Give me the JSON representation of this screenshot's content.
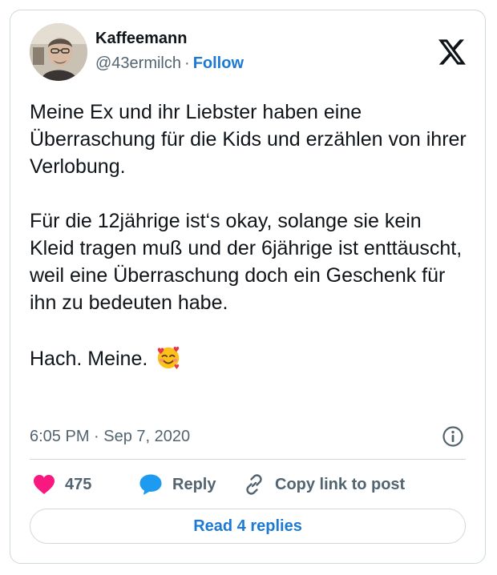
{
  "author": {
    "display_name": "Kaffeemann",
    "handle": "@43ermilch",
    "separator": "·",
    "follow_label": "Follow"
  },
  "tweet": {
    "paragraphs": [
      "Meine Ex und ihr Liebster haben eine Überraschung für die Kids und erzählen von ihrer Verlobung.",
      "Für die 12jährige ist‘s okay, solange sie kein Kleid tragen muß und der 6jährige ist enttäuscht, weil eine Überraschung doch ein Geschenk für ihn zu bedeuten habe.",
      "Hach. Meine."
    ],
    "emoji": "smiling-face-with-hearts-icon",
    "timestamp": "6:05 PM · Sep 7, 2020"
  },
  "actions": {
    "like_count": "475",
    "reply_label": "Reply",
    "copy_link_label": "Copy link to post",
    "read_replies_label": "Read 4 replies"
  },
  "colors": {
    "accent": "#1d7ad4",
    "like": "#f91880",
    "reply_icon": "#1d9bf0",
    "text": "#0f1419",
    "secondary_text": "#536471",
    "border": "#cfd9de"
  }
}
